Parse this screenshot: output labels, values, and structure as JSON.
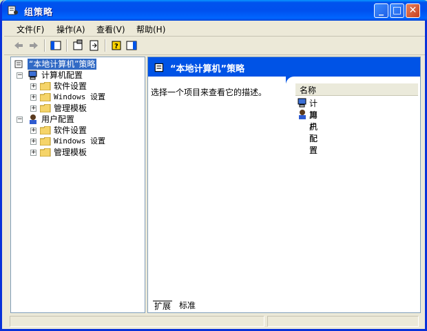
{
  "window": {
    "title": "组策略"
  },
  "menu": [
    {
      "label": "文件(F)"
    },
    {
      "label": "操作(A)"
    },
    {
      "label": "查看(V)"
    },
    {
      "label": "帮助(H)"
    }
  ],
  "tree": {
    "root": "“本地计算机”策略",
    "computer": {
      "label": "计算机配置",
      "children": [
        "软件设置",
        "Windows 设置",
        "管理模板"
      ]
    },
    "user": {
      "label": "用户配置",
      "children": [
        "软件设置",
        "Windows 设置",
        "管理模板"
      ]
    }
  },
  "right": {
    "header": "“本地计算机”策略",
    "description": "选择一个项目来查看它的描述。",
    "list_header": "名称",
    "items": [
      "计算机配置",
      "用户配置"
    ]
  },
  "tabs": [
    "扩展",
    "标准"
  ],
  "colors": {
    "title_blue": "#0053ee",
    "selection": "#316ac5",
    "pane_border": "#7f9db9"
  }
}
